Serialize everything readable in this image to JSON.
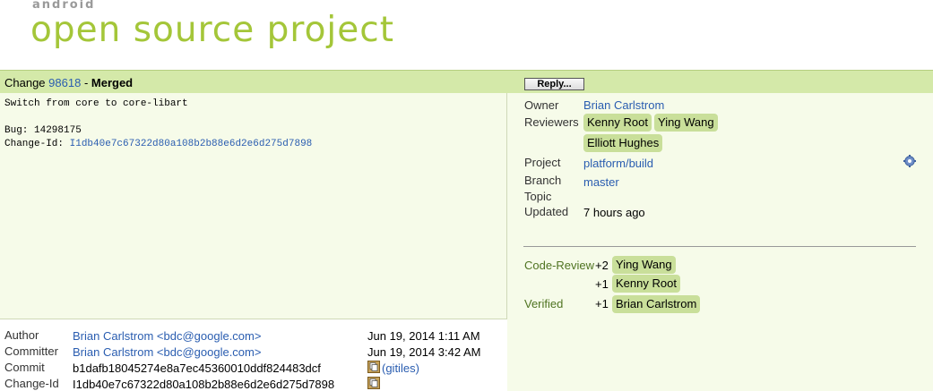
{
  "logo": {
    "small": "android",
    "big": "open source project"
  },
  "change": {
    "label": "Change",
    "number": "98618",
    "separator": " - ",
    "status": "Merged",
    "reply_label": "Reply..."
  },
  "commit_message": {
    "subject": "Switch from core to core-libart",
    "bug_line": "Bug: 14298175",
    "change_id_label": "Change-Id: ",
    "change_id": "I1db40e7c67322d80a108b2b88e6d2e6d275d7898"
  },
  "info": {
    "owner_label": "Owner",
    "owner": "Brian Carlstrom",
    "reviewers_label": "Reviewers",
    "reviewers": [
      "Kenny Root",
      "Ying Wang",
      "Elliott Hughes"
    ],
    "project_label": "Project",
    "project": "platform/build",
    "branch_label": "Branch",
    "branch": "master",
    "topic_label": "Topic",
    "updated_label": "Updated",
    "updated": "7 hours ago"
  },
  "labels": {
    "code_review_label": "Code-Review",
    "code_review": [
      {
        "score": "+2",
        "name": "Ying Wang"
      },
      {
        "score": "+1",
        "name": "Kenny Root"
      }
    ],
    "verified_label": "Verified",
    "verified": [
      {
        "score": "+1",
        "name": "Brian Carlstrom"
      }
    ]
  },
  "commit_info": {
    "author_label": "Author",
    "author": "Brian Carlstrom <bdc@google.com>",
    "author_date": "Jun 19, 2014 1:11 AM",
    "committer_label": "Committer",
    "committer": "Brian Carlstrom <bdc@google.com>",
    "committer_date": "Jun 19, 2014 3:42 AM",
    "commit_label": "Commit",
    "commit": "b1dafb18045274e8a7ec45360010ddf824483dcf",
    "gitiles": "(gitiles)",
    "change_id_label": "Change-Id",
    "change_id": "I1db40e7c67322d80a108b2b88e6d2e6d275d7898"
  },
  "colors": {
    "brand_green": "#a4c639",
    "header_bar": "#d4e9a9",
    "panel_bg": "#f6fbe9",
    "chip_bg": "#c9df9a",
    "link": "#2a5db0"
  },
  "icons": [
    "gear-icon",
    "copy-icon"
  ]
}
